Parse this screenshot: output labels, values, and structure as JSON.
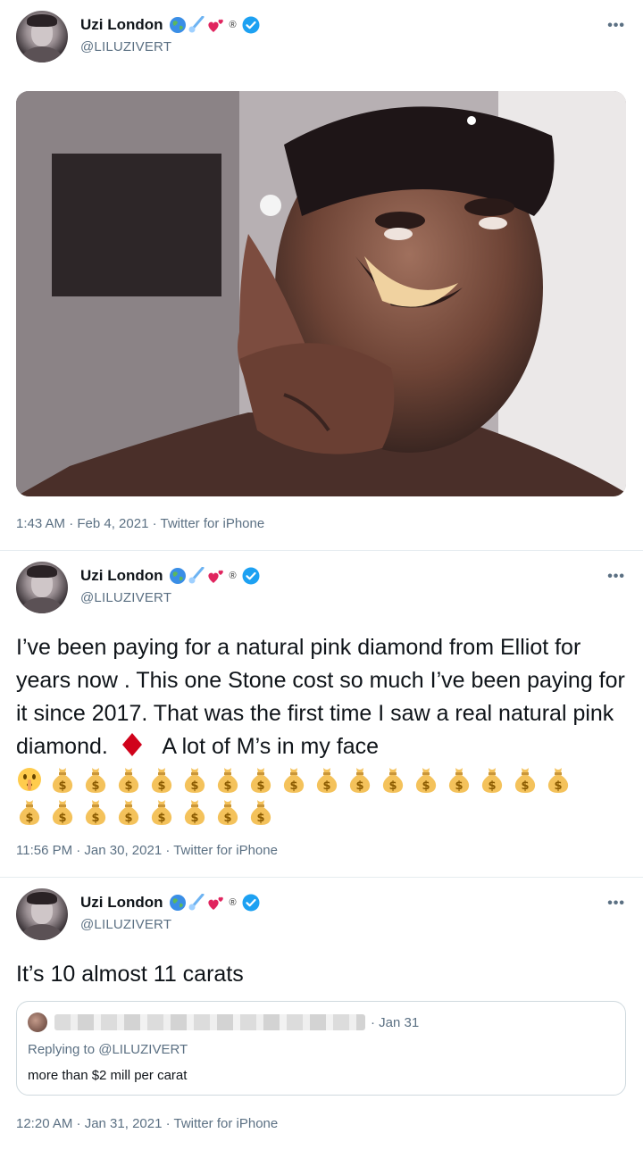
{
  "user": {
    "name": "Uzi London",
    "handle": "@LILUZIVERT",
    "name_emojis": [
      "globe-icon",
      "comet-icon",
      "hearts-icon",
      "registered-icon"
    ]
  },
  "tweets": [
    {
      "has_photo": true,
      "timestamp": "1:43 AM · Feb 4, 2021 · Twitter for iPhone"
    },
    {
      "text_before": "I’ve been paying for a natural pink diamond from Elliot for years now . This one Stone cost so much I’ve been paying for it since 2017. That was the first time I saw a real natural pink diamond.",
      "text_after": "A lot of M’s in my face",
      "money_bags_line1": 16,
      "money_bags_line2": 8,
      "timestamp": "11:56 PM · Jan 30, 2021 · Twitter for iPhone"
    },
    {
      "text": "It’s 10 almost 11 carats",
      "quote": {
        "date": "· Jan 31",
        "replying": "Replying to @LILUZIVERT",
        "text": "more than $2 mill per carat"
      },
      "timestamp": "12:20 AM · Jan 31, 2021 · Twitter for iPhone"
    }
  ],
  "colors": {
    "verified": "#1da1f2",
    "muted": "#5b7083",
    "diamond": "#d0021b",
    "divider": "#e6ecf0"
  }
}
